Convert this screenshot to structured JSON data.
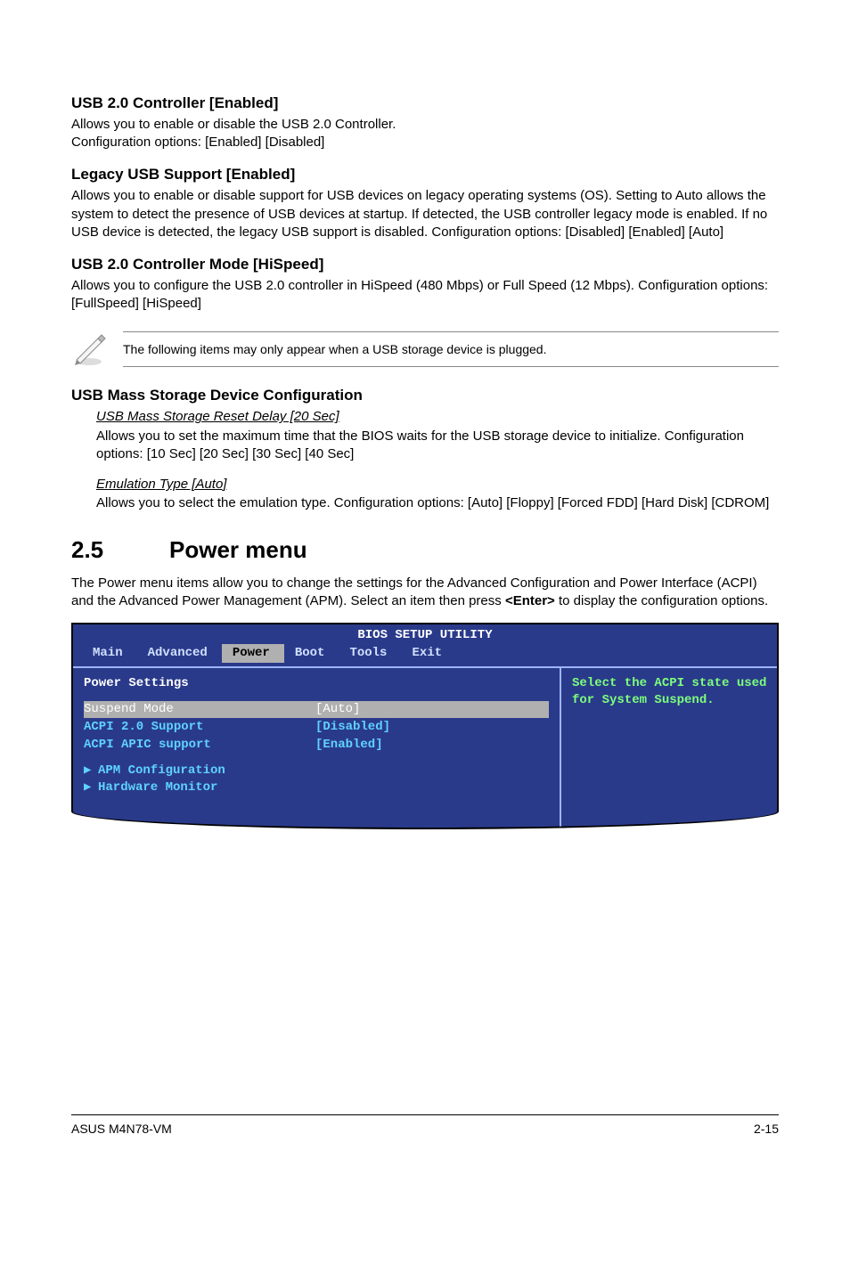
{
  "s1": {
    "h": "USB 2.0 Controller [Enabled]",
    "p": "Allows you to enable or disable the USB 2.0 Controller.\nConfiguration options: [Enabled] [Disabled]"
  },
  "s2": {
    "h": "Legacy USB Support [Enabled]",
    "p": "Allows you to enable or disable support for USB devices on legacy operating systems (OS). Setting to Auto allows the system to detect the presence of USB devices at startup. If detected, the USB controller legacy mode is enabled. If no USB device is detected, the legacy USB support is disabled. Configuration options: [Disabled] [Enabled] [Auto]"
  },
  "s3": {
    "h": "USB 2.0 Controller Mode [HiSpeed]",
    "p": "Allows you to configure the USB 2.0 controller in HiSpeed (480 Mbps) or Full Speed (12 Mbps). Configuration options: [FullSpeed] [HiSpeed]"
  },
  "note": "The following items may only appear when a USB storage device is plugged.",
  "s4": {
    "h": "USB Mass Storage Device Configuration",
    "sub1_t": "USB Mass Storage Reset Delay [20 Sec]",
    "sub1_p": "Allows you to set the maximum time that the BIOS waits for the USB storage device to initialize. Configuration options: [10 Sec] [20 Sec] [30 Sec] [40 Sec]",
    "sub2_t": "Emulation Type [Auto]",
    "sub2_p": "Allows you to select the emulation type. Configuration options: [Auto] [Floppy] [Forced FDD] [Hard Disk] [CDROM]"
  },
  "pm": {
    "num": "2.5",
    "title": "Power menu",
    "desc_a": "The Power menu items allow you to change the settings for the Advanced Configuration and Power Interface (ACPI) and the Advanced Power Management (APM). Select an item then press ",
    "desc_key": "<Enter>",
    "desc_b": " to display the configuration options."
  },
  "bios": {
    "title": "BIOS SETUP UTILITY",
    "tabs": {
      "t1": "Main",
      "t2": "Advanced",
      "t3": "Power",
      "t4": "Boot",
      "t5": "Tools",
      "t6": "Exit"
    },
    "heading": "Power Settings",
    "rows": {
      "r1l": "Suspend Mode",
      "r1v": "[Auto]",
      "r2l": "ACPI 2.0 Support",
      "r2v": "[Disabled]",
      "r3l": "ACPI APIC support",
      "r3v": "[Enabled]",
      "r4": "APM Configuration",
      "r5": "Hardware Monitor"
    },
    "help": "Select the ACPI state used for System Suspend."
  },
  "footer": {
    "left": "ASUS M4N78-VM",
    "right": "2-15"
  }
}
